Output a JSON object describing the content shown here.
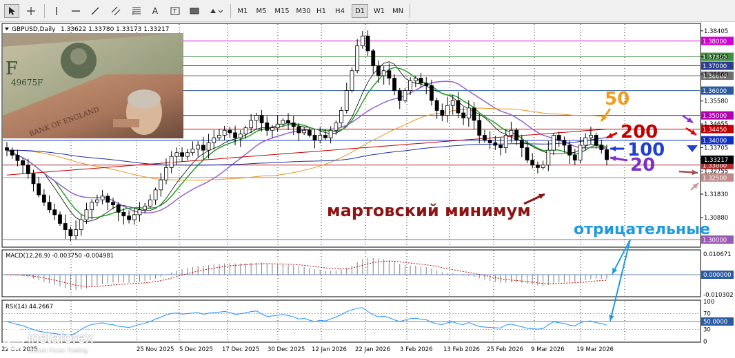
{
  "toolbar": {
    "icons": [
      "cursor-icon",
      "crosshair-icon",
      "vertical-line-icon",
      "horizontal-line-icon",
      "trendline-icon",
      "channel-icon",
      "fibonacci-icon",
      "text-icon",
      "text-label-icon",
      "rectangle-icon",
      "shapes-icon"
    ],
    "timeframes": [
      "M1",
      "M5",
      "M15",
      "M30",
      "H1",
      "H4",
      "D1",
      "W1",
      "MN"
    ],
    "active_timeframe": "D1"
  },
  "header": {
    "symbol": "GBPUSD,Daily",
    "ohlc": "1.33622 1.33780 1.33173 1.33217"
  },
  "price_axis": {
    "ticks": [
      "1.38405",
      "1.37360",
      "1.36660",
      "1.35580",
      "1.34655",
      "1.33705",
      "1.33217",
      "1.32755",
      "1.31830",
      "1.30880"
    ],
    "current_price": "1.33217"
  },
  "levels": [
    {
      "label": "1.38000",
      "value": 1.38,
      "color": "#d000d0"
    },
    {
      "label": "1.37360",
      "value": 1.3736,
      "color": "#3f8f3f"
    },
    {
      "label": "1.37000",
      "value": 1.37,
      "color": "#2b3f8f"
    },
    {
      "label": "1.36600",
      "value": 1.366,
      "color": "#6e6e6e"
    },
    {
      "label": "1.36000",
      "value": 1.36,
      "color": "#2b5aa0"
    },
    {
      "label": "1.35000",
      "value": 1.35,
      "color": "#b000b0"
    },
    {
      "label": "1.34450",
      "value": 1.3445,
      "color": "#c00000"
    },
    {
      "label": "1.34000",
      "value": 1.34,
      "color": "#1030c0"
    },
    {
      "label": "1.33000",
      "value": 1.33,
      "color": "#b03030"
    },
    {
      "label": "1.32500",
      "value": 1.325,
      "color": "#c08a8a"
    },
    {
      "label": "1.30000",
      "value": 1.3,
      "color": "#9a59b5"
    }
  ],
  "time_axis": [
    "22 Oct 2025",
    "",
    "25 Nov 2025",
    "5 Dec 2025",
    "17 Dec 2025",
    "30 Dec 2025",
    "12 Jan 2026",
    "22 Jan 2026",
    "3 Feb 2026",
    "13 Feb 2026",
    "25 Feb 2026",
    "9 Mar 2026",
    "19 Mar 2026"
  ],
  "macd": {
    "label": "MACD(12,26,9) -0.003750 -0.004981",
    "ticks": [
      "0.010671",
      "0.000000",
      "-0.010302"
    ]
  },
  "rsi": {
    "label": "RSI(14) 44.2667",
    "ticks": [
      "100",
      "70",
      "50.0000",
      "30",
      "0"
    ]
  },
  "annotations": {
    "ma50": "50",
    "ma200": "200",
    "ma100": "100",
    "ma20": "20",
    "march_low": "мартовский минимум",
    "negative": "отрицательные"
  },
  "logo": {
    "brand": "instaforex",
    "tagline": "Instant Forex Trading"
  },
  "chart_data": {
    "type": "candlestick",
    "timeframe": "D1",
    "x_labels": [
      "22 Oct 2025",
      "25 Nov 2025",
      "5 Dec 2025",
      "17 Dec 2025",
      "30 Dec 2025",
      "12 Jan 2026",
      "22 Jan 2026",
      "3 Feb 2026",
      "13 Feb 2026",
      "25 Feb 2026",
      "9 Mar 2026",
      "19 Mar 2026"
    ],
    "ylim": [
      1.2975,
      1.3865
    ],
    "last": {
      "open": 1.33622,
      "high": 1.3378,
      "low": 1.33173,
      "close": 1.33217
    },
    "closes": [
      1.336,
      1.334,
      1.3318,
      1.33,
      1.3265,
      1.3225,
      1.318,
      1.315,
      1.312,
      1.31,
      1.3065,
      1.304,
      1.3015,
      1.304,
      1.308,
      1.312,
      1.315,
      1.316,
      1.3175,
      1.315,
      1.314,
      1.311,
      1.3095,
      1.308,
      1.31,
      1.312,
      1.3135,
      1.316,
      1.32,
      1.324,
      1.329,
      1.3335,
      1.335,
      1.3335,
      1.335,
      1.3365,
      1.338,
      1.336,
      1.339,
      1.341,
      1.342,
      1.344,
      1.343,
      1.341,
      1.3425,
      1.345,
      1.348,
      1.35,
      1.347,
      1.344,
      1.345,
      1.3465,
      1.348,
      1.347,
      1.3455,
      1.343,
      1.344,
      1.342,
      1.34,
      1.342,
      1.341,
      1.344,
      1.347,
      1.352,
      1.36,
      1.368,
      1.378,
      1.382,
      1.376,
      1.37,
      1.366,
      1.368,
      1.365,
      1.36,
      1.356,
      1.36,
      1.364,
      1.365,
      1.363,
      1.362,
      1.356,
      1.352,
      1.35,
      1.354,
      1.356,
      1.351,
      1.349,
      1.353,
      1.348,
      1.342,
      1.34,
      1.339,
      1.338,
      1.337,
      1.342,
      1.344,
      1.34,
      1.337,
      1.332,
      1.33,
      1.329,
      1.33,
      1.336,
      1.342,
      1.34,
      1.338,
      1.334,
      1.332,
      1.338,
      1.341,
      1.342,
      1.338,
      1.3362,
      1.3322
    ],
    "ma_periods": [
      20,
      50,
      100,
      200
    ],
    "macd": {
      "value": -0.00375,
      "signal": -0.004981
    },
    "rsi": {
      "value": 44.2667,
      "levels": [
        30,
        50,
        70
      ]
    }
  }
}
